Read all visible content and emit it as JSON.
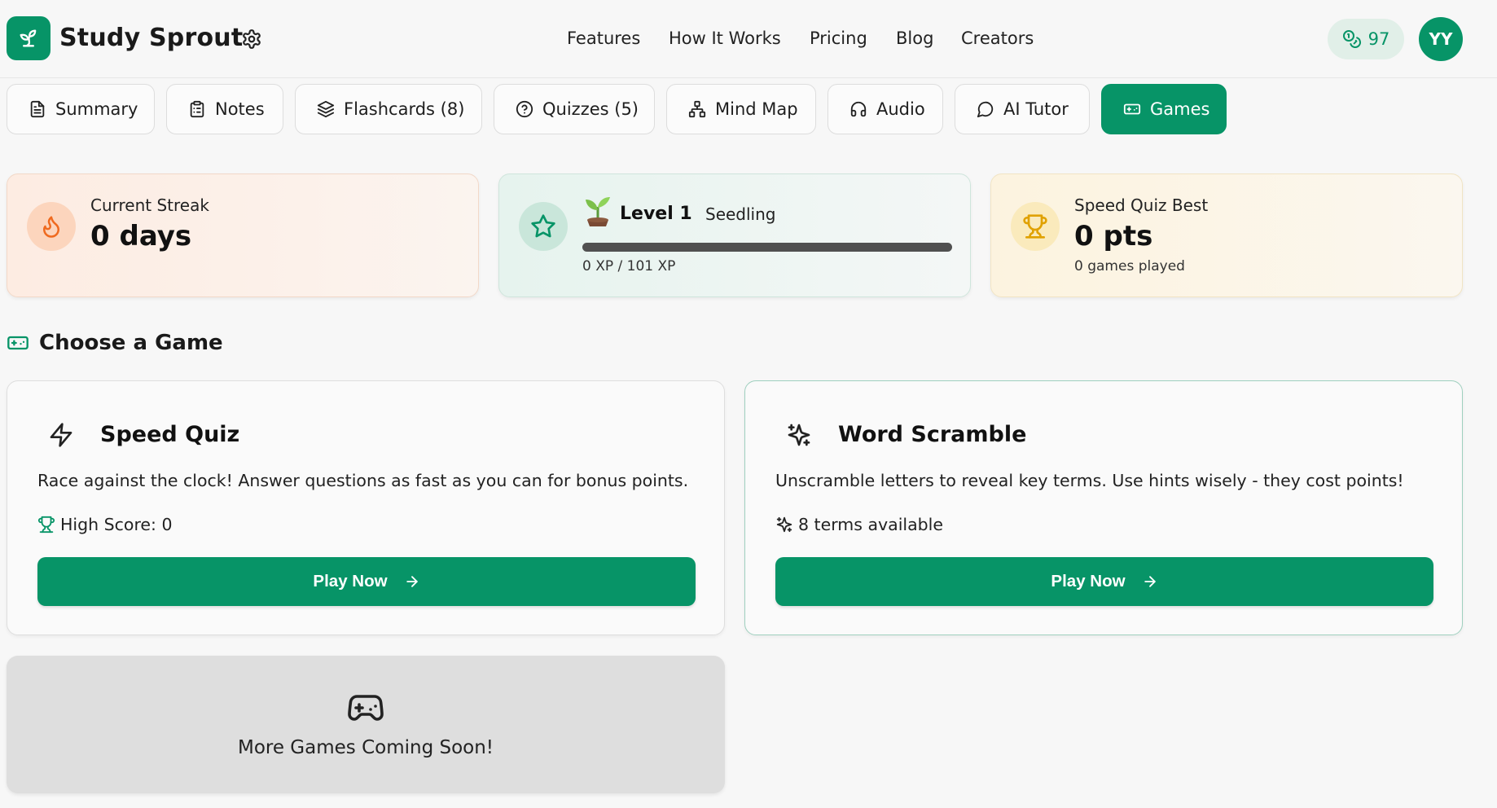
{
  "header": {
    "brand": "Study Sprout",
    "nav": [
      "Features",
      "How It Works",
      "Pricing",
      "Blog",
      "Creators"
    ],
    "credits": "97",
    "avatar_initials": "YY"
  },
  "tabs": [
    {
      "label": "Summary",
      "icon": "document-icon",
      "active": false
    },
    {
      "label": "Notes",
      "icon": "clipboard-icon",
      "active": false
    },
    {
      "label": "Flashcards (8)",
      "icon": "layers-icon",
      "active": false
    },
    {
      "label": "Quizzes (5)",
      "icon": "help-circle-icon",
      "active": false
    },
    {
      "label": "Mind Map",
      "icon": "network-icon",
      "active": false
    },
    {
      "label": "Audio",
      "icon": "headphones-icon",
      "active": false
    },
    {
      "label": "AI Tutor",
      "icon": "chat-bubble-icon",
      "active": false
    },
    {
      "label": "Games",
      "icon": "gamepad-icon",
      "active": true
    }
  ],
  "stats": {
    "streak": {
      "label": "Current Streak",
      "value": "0 days",
      "icon": "flame-icon"
    },
    "level": {
      "level_label": "Level 1",
      "rank": "Seedling",
      "emoji": "🌱",
      "xp_text": "0 XP / 101 XP",
      "xp_fraction": 0,
      "icon": "star-icon"
    },
    "speed": {
      "label": "Speed Quiz Best",
      "value": "0 pts",
      "sub": "0 games played",
      "icon": "trophy-icon"
    }
  },
  "section_title": "Choose a Game",
  "games": [
    {
      "title": "Speed Quiz",
      "description": "Race against the clock! Answer questions as fast as you can for bonus points.",
      "meta": "High Score: 0",
      "button": "Play Now",
      "icon": "lightning-icon",
      "meta_icon": "trophy-icon"
    },
    {
      "title": "Word Scramble",
      "description": "Unscramble letters to reveal key terms. Use hints wisely - they cost points!",
      "meta": "8 terms available",
      "button": "Play Now",
      "icon": "sparkles-icon",
      "meta_icon": "sparkles-icon"
    }
  ],
  "coming_soon": "More Games Coming Soon!",
  "colors": {
    "brand_green": "#079467",
    "credits_bg": "#e1efe8",
    "streak_bg": "#fdece2",
    "level_bg": "#e6f3ee",
    "speed_bg": "#fcf3df"
  }
}
